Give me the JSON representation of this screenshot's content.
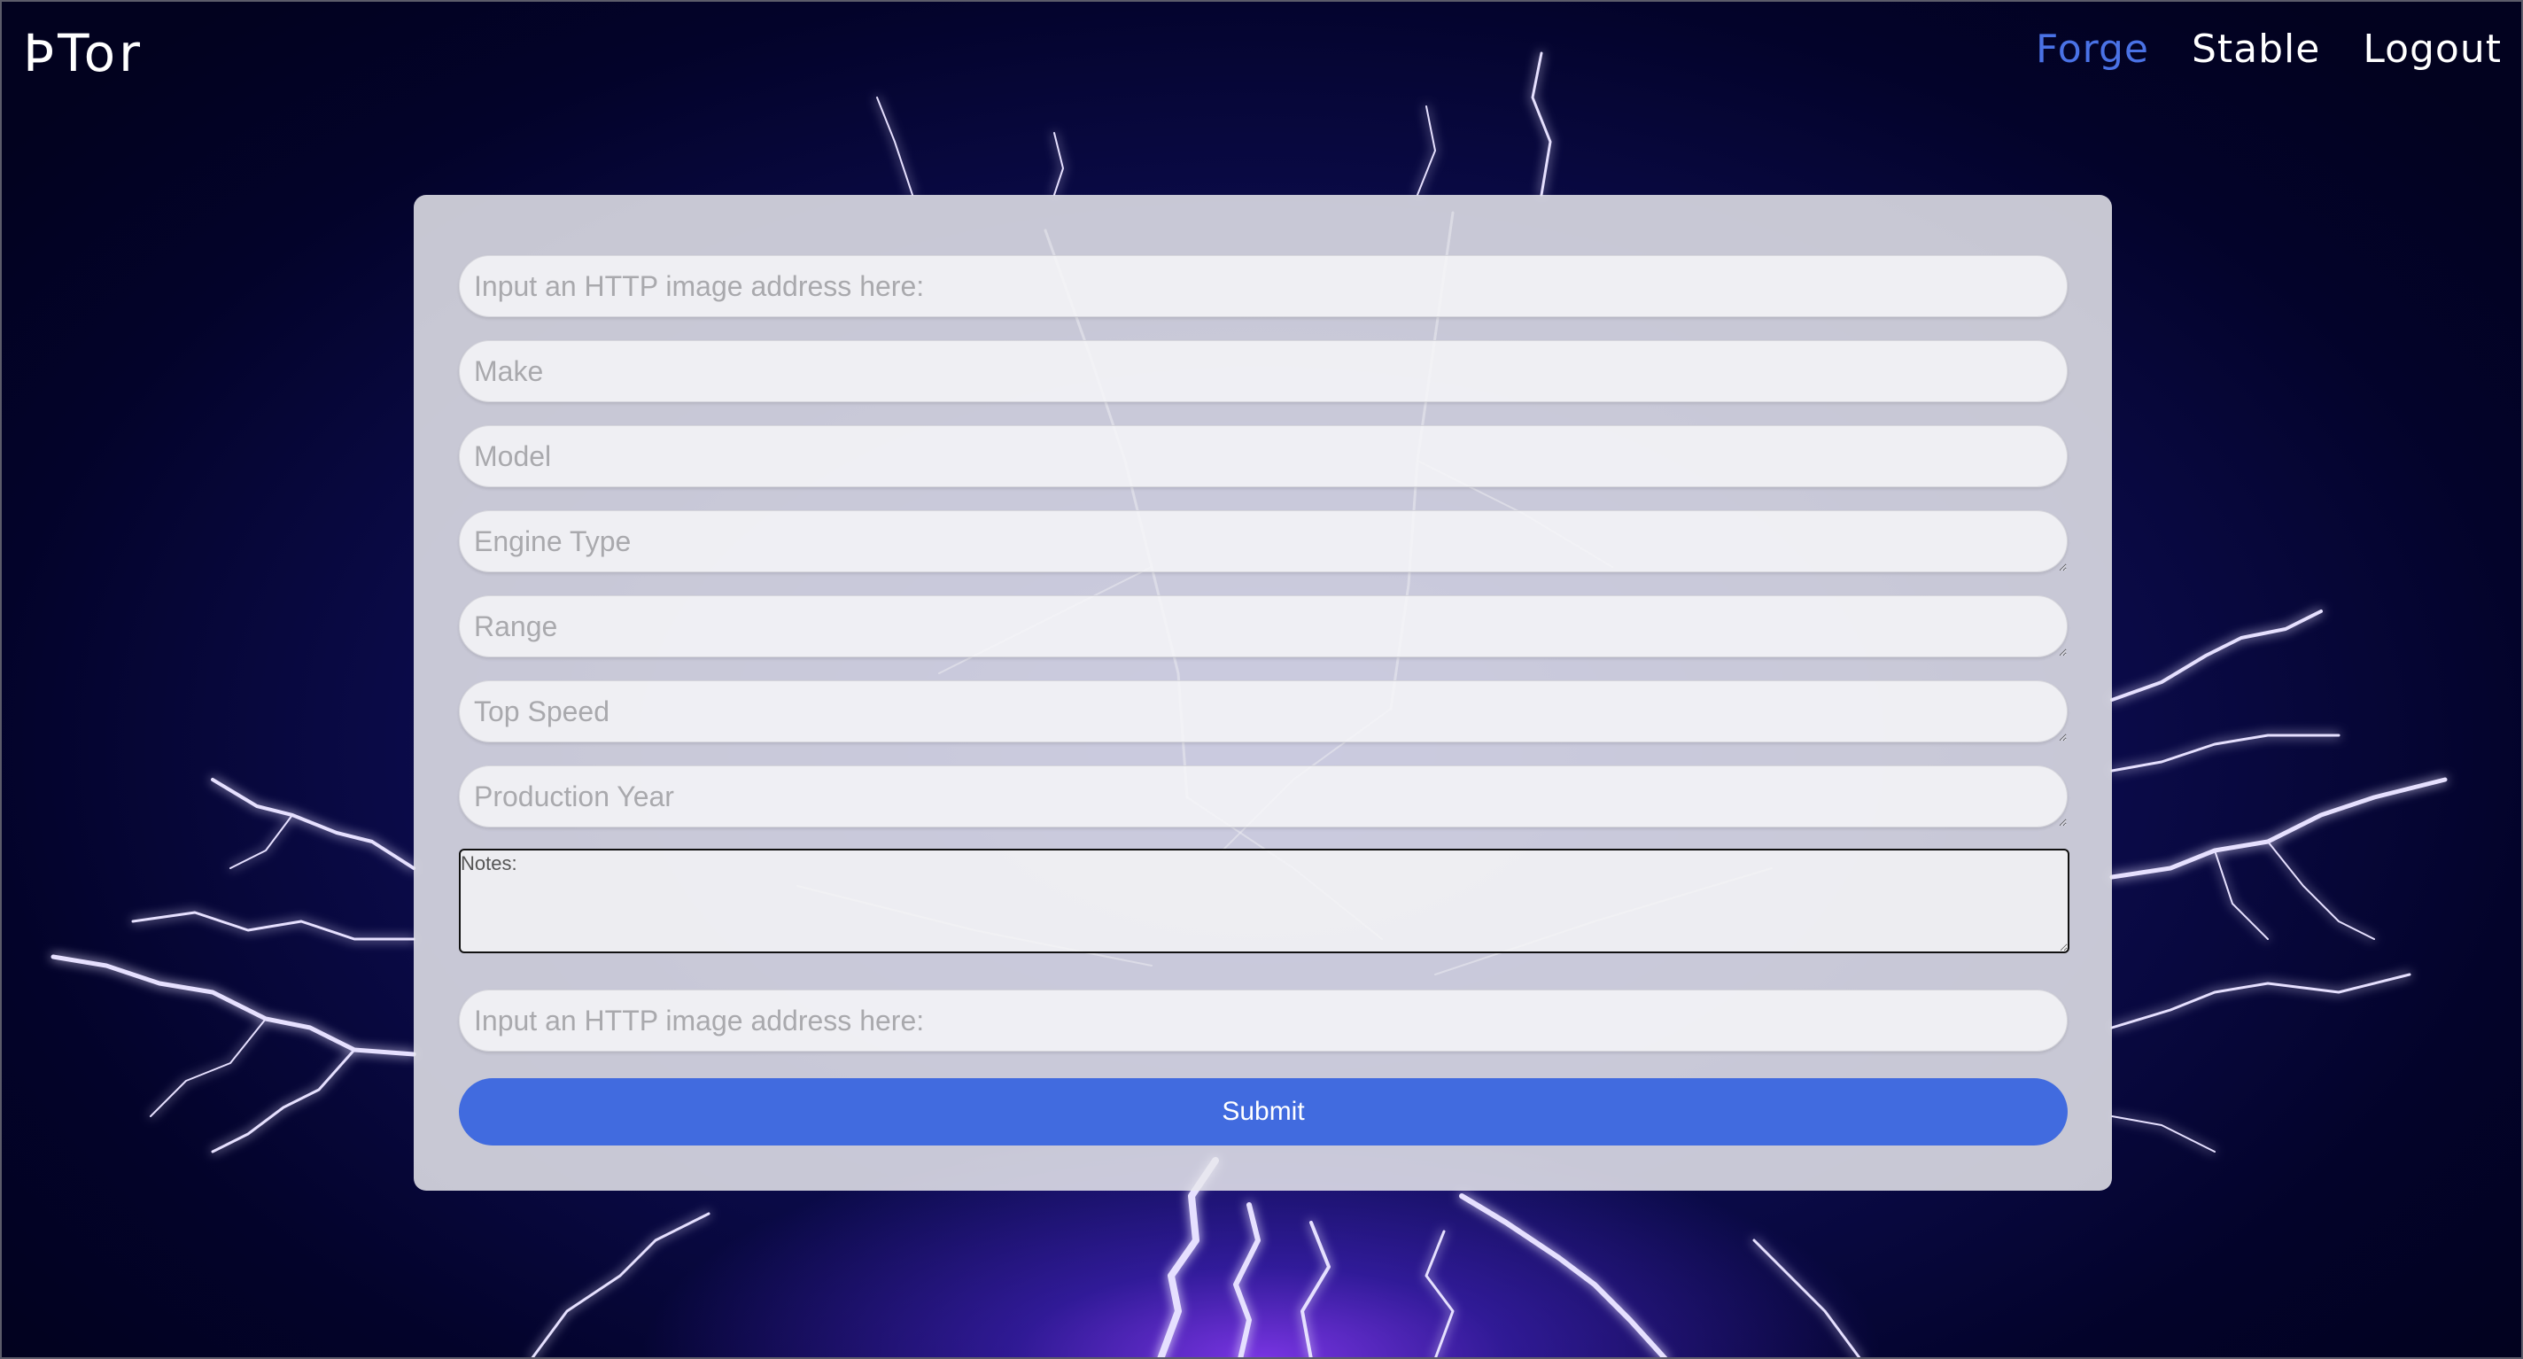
{
  "brand": {
    "logo_text": "ÞTor"
  },
  "nav": {
    "items": [
      {
        "label": "Forge",
        "active": true
      },
      {
        "label": "Stable",
        "active": false
      },
      {
        "label": "Logout",
        "active": false
      }
    ],
    "active_color": "#4a72e6"
  },
  "form": {
    "image_url_top": {
      "placeholder": "Input an HTTP image address here:",
      "value": ""
    },
    "make": {
      "placeholder": "Make",
      "value": ""
    },
    "model": {
      "placeholder": "Model",
      "value": ""
    },
    "engine_type": {
      "placeholder": "Engine Type",
      "value": ""
    },
    "range": {
      "placeholder": "Range",
      "value": ""
    },
    "top_speed": {
      "placeholder": "Top Speed",
      "value": ""
    },
    "production_year": {
      "placeholder": "Production Year",
      "value": ""
    },
    "notes": {
      "placeholder": "Notes:",
      "value": ""
    },
    "image_url_bottom": {
      "placeholder": "Input an HTTP image address here:",
      "value": ""
    },
    "submit_label": "Submit"
  },
  "colors": {
    "background": "#0d0d52",
    "lightning": "#e8e4ff",
    "submit": "#416bdf"
  },
  "background_icon": "lightning-bolts-icon"
}
